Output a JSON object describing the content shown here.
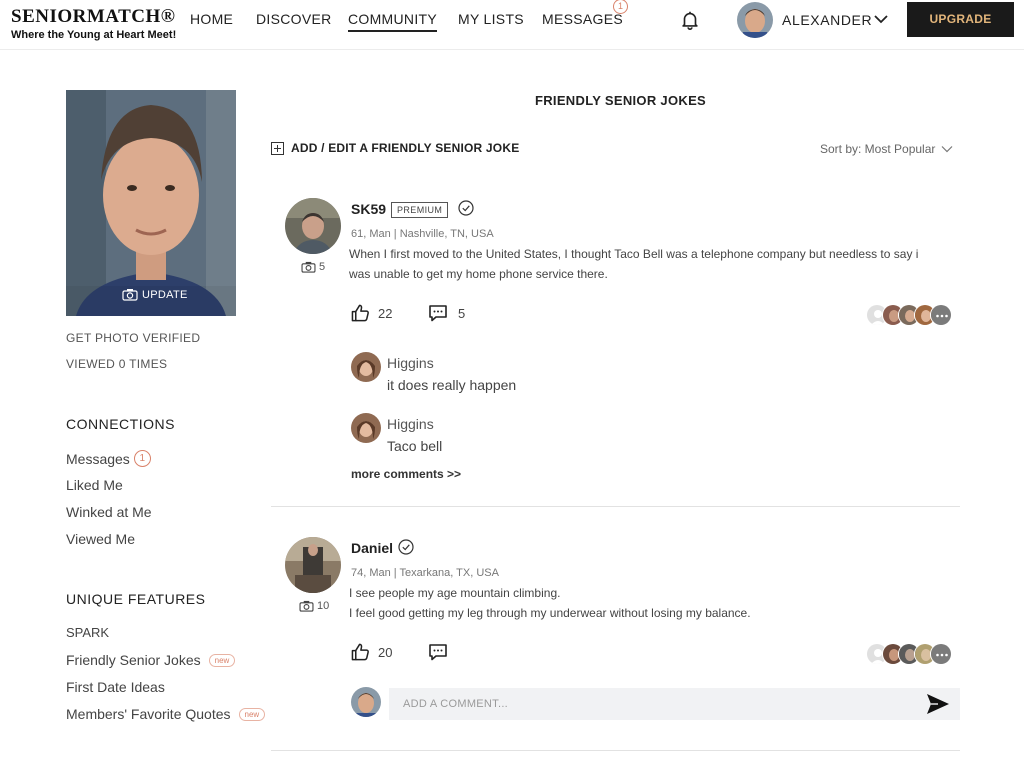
{
  "header": {
    "logo_name": "SENIORMATCH®",
    "logo_tagline": "Where the Young at Heart Meet!",
    "nav": [
      {
        "label": "HOME"
      },
      {
        "label": "DISCOVER"
      },
      {
        "label": "COMMUNITY"
      },
      {
        "label": "MY LISTS"
      },
      {
        "label": "MESSAGES"
      }
    ],
    "messages_badge": "1",
    "active_nav": "COMMUNITY",
    "user_name": "ALEXANDER",
    "upgrade_label": "UPGRADE",
    "icons": [
      "bell-icon",
      "chevron-down-icon"
    ]
  },
  "sidebar": {
    "photo_update_label": "UPDATE",
    "get_verified": "GET PHOTO VERIFIED",
    "viewed": "VIEWED 0 TIMES",
    "connections_title": "CONNECTIONS",
    "connections": [
      {
        "label": "Messages",
        "badge": "1"
      },
      {
        "label": "Liked Me"
      },
      {
        "label": "Winked at Me"
      },
      {
        "label": "Viewed Me"
      }
    ],
    "features_title": "UNIQUE FEATURES",
    "features": [
      {
        "label": "SPARK"
      },
      {
        "label": "Friendly Senior Jokes",
        "tag": "new"
      },
      {
        "label": "First Date Ideas"
      },
      {
        "label": "Members' Favorite Quotes",
        "tag": "new"
      }
    ]
  },
  "main": {
    "title": "FRIENDLY SENIOR JOKES",
    "add_label": "ADD / EDIT A FRIENDLY SENIOR JOKE",
    "sort_label": "Sort by: Most Popular",
    "posts": [
      {
        "username": "SK59",
        "badge": "PREMIUM",
        "photo_count": "5",
        "meta": "61, Man | Nashville, TN, USA",
        "lines": [
          "When I first moved to the United States, I thought Taco Bell was a telephone company but needless to say i",
          "was unable to get my home phone service there."
        ],
        "likes": "22",
        "comments": "5",
        "comment_list": [
          {
            "name": "Higgins",
            "text": "it does really happen"
          },
          {
            "name": "Higgins",
            "text": "Taco bell"
          }
        ],
        "more_comments": "more comments >>",
        "reactor_colors": [
          "#d9d9d9",
          "#8a5c4e",
          "#b98a72",
          "#a0683f",
          "#7b7b7b"
        ]
      },
      {
        "username": "Daniel",
        "photo_count": "10",
        "meta": "74, Man | Texarkana, TX, USA",
        "lines": [
          "I see people my age mountain climbing.",
          "I feel good getting my leg through my underwear without losing my balance."
        ],
        "likes": "20",
        "comments": "",
        "comment_placeholder": "ADD A COMMENT...",
        "reactor_colors": [
          "#d9d9d9",
          "#6b4a3c",
          "#5a5a5a",
          "#b0a070",
          "#7b7b7b"
        ]
      }
    ]
  },
  "colors": {
    "accent": "#d9826a",
    "upgrade_bg": "#1a1a1a",
    "upgrade_text": "#e2b57b",
    "divider": "#e2e2e2"
  }
}
